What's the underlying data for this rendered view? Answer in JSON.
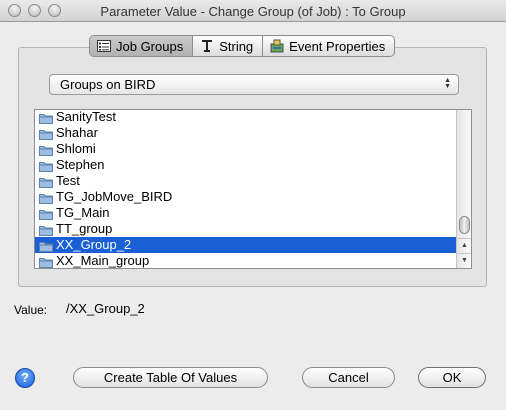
{
  "window": {
    "title": "Parameter Value - Change Group (of Job) : To Group"
  },
  "tabs": [
    {
      "label": "Job Groups",
      "icon": "list-icon",
      "active": true
    },
    {
      "label": "String",
      "icon": "text-cursor-icon",
      "active": false
    },
    {
      "label": "Event Properties",
      "icon": "event-properties-icon",
      "active": false
    }
  ],
  "group_select": {
    "value": "Groups on BIRD"
  },
  "group_list": {
    "items": [
      "SanityTest",
      "Shahar",
      "Shlomi",
      "Stephen",
      "Test",
      "TG_JobMove_BIRD",
      "TG_Main",
      "TT_group",
      "XX_Group_2",
      "XX_Main_group"
    ],
    "selected": "XX_Group_2"
  },
  "value": {
    "label": "Value:",
    "text": "/XX_Group_2"
  },
  "buttons": {
    "help": "?",
    "create": "Create Table Of Values",
    "cancel": "Cancel",
    "ok": "OK"
  },
  "colors": {
    "selection": "#1a5fd3",
    "folder": "#7fa3c9"
  }
}
